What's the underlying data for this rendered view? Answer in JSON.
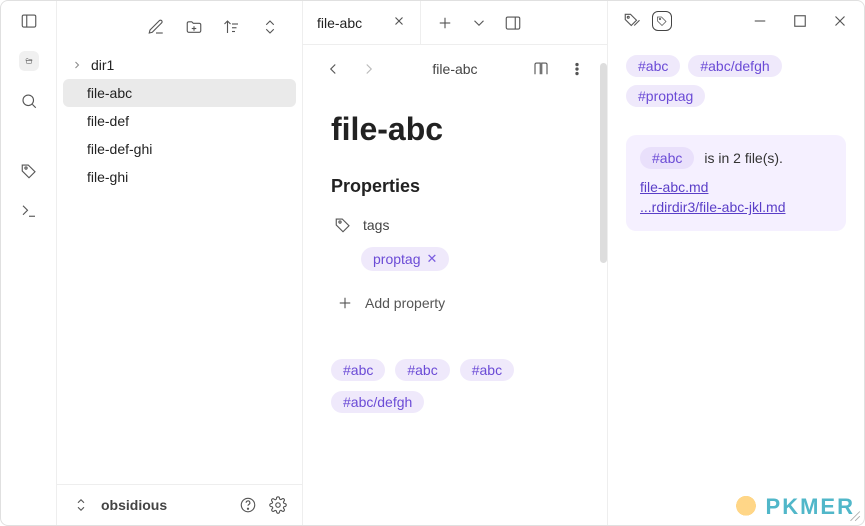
{
  "rail": {
    "icons": [
      "panel-left",
      "folder-open",
      "search",
      "tag",
      "terminal"
    ]
  },
  "sidebar": {
    "toolbar": [
      "edit",
      "new-folder",
      "sort",
      "collapse"
    ],
    "items": [
      {
        "name": "dir1",
        "type": "folder"
      },
      {
        "name": "file-abc",
        "type": "file",
        "selected": true
      },
      {
        "name": "file-def",
        "type": "file"
      },
      {
        "name": "file-def-ghi",
        "type": "file"
      },
      {
        "name": "file-ghi",
        "type": "file"
      }
    ],
    "vault": "obsidious"
  },
  "tabs": [
    {
      "title": "file-abc"
    }
  ],
  "breadcrumb": "file-abc",
  "doc": {
    "title": "file-abc",
    "properties_heading": "Properties",
    "tags_label": "tags",
    "property_tags": [
      "proptag"
    ],
    "add_property_label": "Add property",
    "body_tags": [
      "#abc",
      "#abc",
      "#abc",
      "#abc/defgh"
    ]
  },
  "right": {
    "tag_cloud": [
      "#abc",
      "#abc/defgh",
      "#proptag"
    ],
    "selected_tag": "#abc",
    "file_count_text": "is in 2 file(s).",
    "files": [
      "file-abc.md",
      "...rdirdir3/file-abc-jkl.md"
    ]
  },
  "watermark": "PKMER"
}
